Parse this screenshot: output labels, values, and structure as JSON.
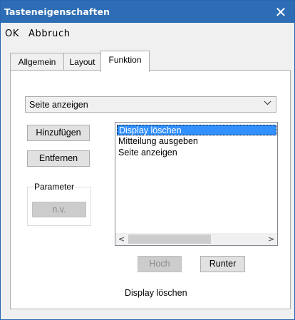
{
  "window": {
    "title": "Tasteneigenschaften",
    "close_glyph": "✕"
  },
  "menu": {
    "ok": "OK",
    "cancel": "Abbruch"
  },
  "tabs": [
    {
      "label": "Allgemein",
      "active": false
    },
    {
      "label": "Layout",
      "active": false
    },
    {
      "label": "Funktion",
      "active": true
    }
  ],
  "function_combo": {
    "value": "Seite anzeigen",
    "arrow_icon": "chevron-down-icon"
  },
  "buttons": {
    "add": "Hinzufügen",
    "remove": "Entfernen",
    "up": "Hoch",
    "down": "Runter"
  },
  "parameter_group": {
    "legend": "Parameter",
    "value_button": "n.v."
  },
  "action_list": {
    "items": [
      {
        "label": "Display löschen",
        "selected": true
      },
      {
        "label": "Mitteilung ausgeben",
        "selected": false
      },
      {
        "label": "Seite anzeigen",
        "selected": false
      }
    ],
    "scroll_left": "<",
    "scroll_right": ">"
  },
  "selected_description": "Display löschen",
  "colors": {
    "titlebar": "#2d6db5",
    "selection": "#3390ff"
  }
}
